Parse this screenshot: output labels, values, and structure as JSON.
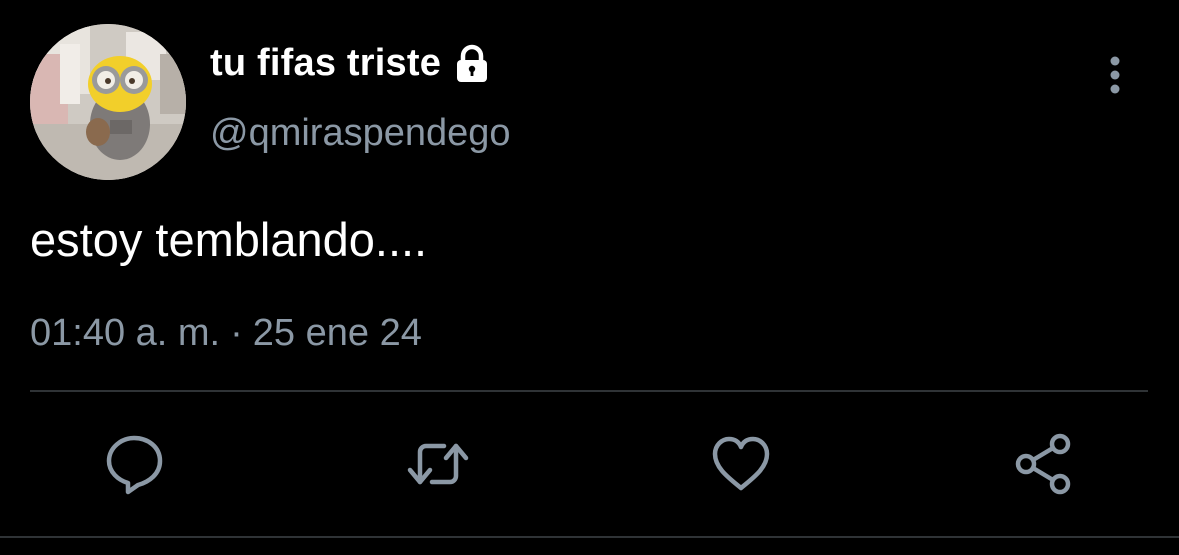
{
  "user": {
    "display_name": "tu fifas triste",
    "handle": "@qmiraspendego",
    "verified_icon": "lock-icon",
    "avatar": "avatar"
  },
  "tweet": {
    "text": "estoy temblando....",
    "time": "01:40 a. m.",
    "separator": "·",
    "date": "25 ene 24"
  },
  "actions": [
    {
      "icon": "reply-icon"
    },
    {
      "icon": "retweet-icon"
    },
    {
      "icon": "like-icon"
    },
    {
      "icon": "share-icon"
    }
  ],
  "menu": {
    "icon": "more-vertical-icon"
  },
  "colors": {
    "background": "#000000",
    "primary_text": "#ffffff",
    "secondary_text": "#8b98a5",
    "divider": "#2f3336"
  }
}
